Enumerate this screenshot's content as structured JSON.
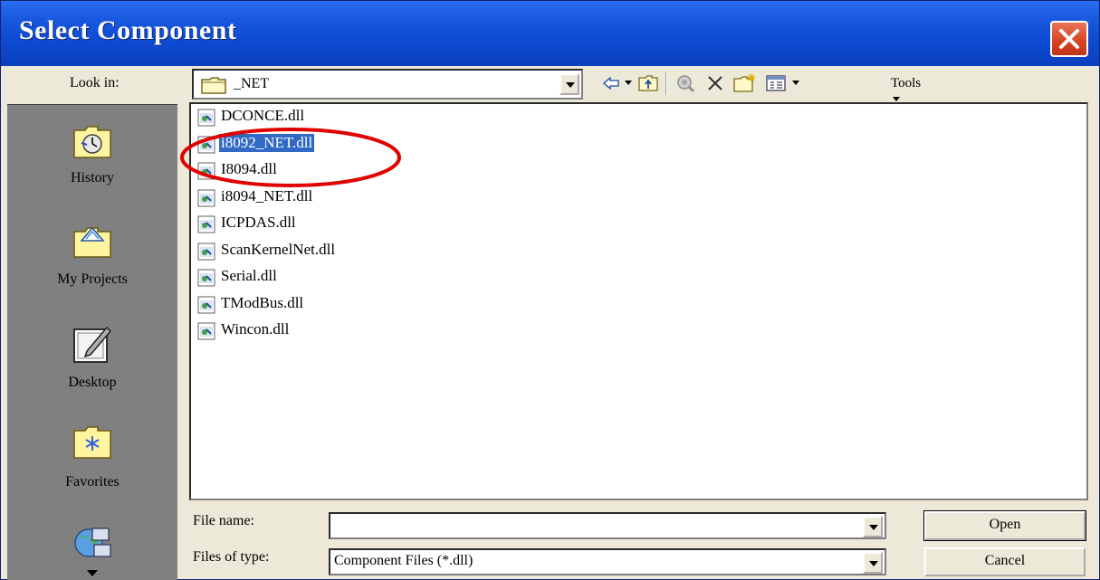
{
  "window": {
    "title": "Select Component"
  },
  "look_in": {
    "label": "Look in:",
    "value": "_NET"
  },
  "toolbar": {
    "tools_label": "Tools"
  },
  "places": [
    {
      "label": "History",
      "icon": "history-icon"
    },
    {
      "label": "My Projects",
      "icon": "my-projects-icon"
    },
    {
      "label": "Desktop",
      "icon": "desktop-icon"
    },
    {
      "label": "Favorites",
      "icon": "favorites-icon"
    },
    {
      "label": "",
      "icon": "network-icon"
    }
  ],
  "files": [
    {
      "name": "DCONCE.dll",
      "selected": false
    },
    {
      "name": "i8092_NET.dll",
      "selected": true
    },
    {
      "name": "I8094.dll",
      "selected": false
    },
    {
      "name": "i8094_NET.dll",
      "selected": false
    },
    {
      "name": "ICPDAS.dll",
      "selected": false
    },
    {
      "name": "ScanKernelNet.dll",
      "selected": false
    },
    {
      "name": "Serial.dll",
      "selected": false
    },
    {
      "name": "TModBus.dll",
      "selected": false
    },
    {
      "name": "Wincon.dll",
      "selected": false
    }
  ],
  "file_name": {
    "label": "File name:",
    "value": ""
  },
  "file_type": {
    "label": "Files of type:",
    "value": "Component Files (*.dll)"
  },
  "buttons": {
    "open": "Open",
    "cancel": "Cancel"
  },
  "colors": {
    "title_bar": "#0d4bd2",
    "selection": "#316ac5",
    "highlight_ring": "#e00000"
  }
}
